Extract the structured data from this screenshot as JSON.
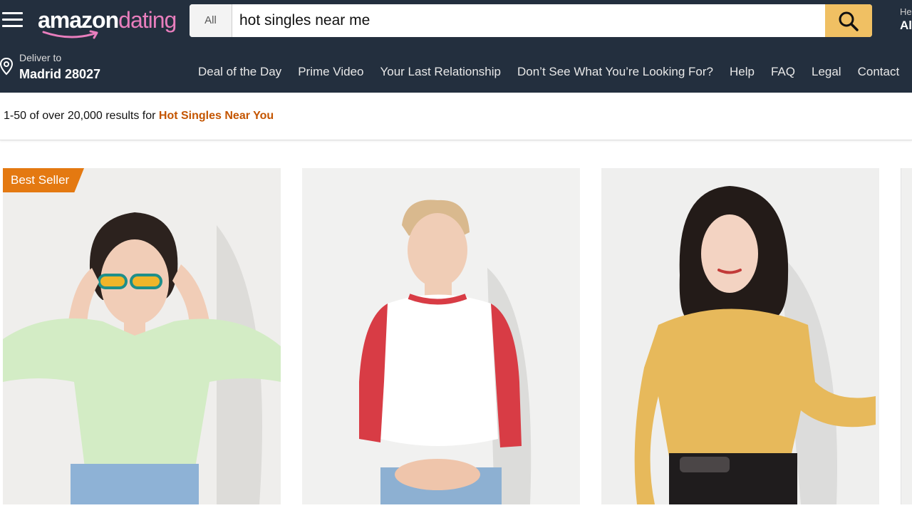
{
  "header": {
    "logo_amazon": "amazon",
    "logo_dating": "dating",
    "search_category": "All",
    "search_value": "hot singles near me",
    "account_small": "He",
    "account_big": "Al",
    "deliver_label": "Deliver to",
    "deliver_location": "Madrid 28027"
  },
  "nav": {
    "items": [
      "Deal of the Day",
      "Prime Video",
      "Your Last Relationship",
      "Don’t See What You’re Looking For?",
      "Help",
      "FAQ",
      "Legal",
      "Contact"
    ]
  },
  "results": {
    "prefix": "1-50 of over 20,000 results for ",
    "query": "Hot Singles Near You"
  },
  "products": [
    {
      "badge": "Best Seller"
    },
    {},
    {}
  ],
  "colors": {
    "header_bg": "#232f3e",
    "search_button": "#f0c063",
    "badge": "#e47911",
    "query_accent": "#c45500",
    "logo_pink": "#e87ebd"
  },
  "icons": [
    "hamburger-menu-icon",
    "search-icon",
    "location-pin-icon"
  ]
}
